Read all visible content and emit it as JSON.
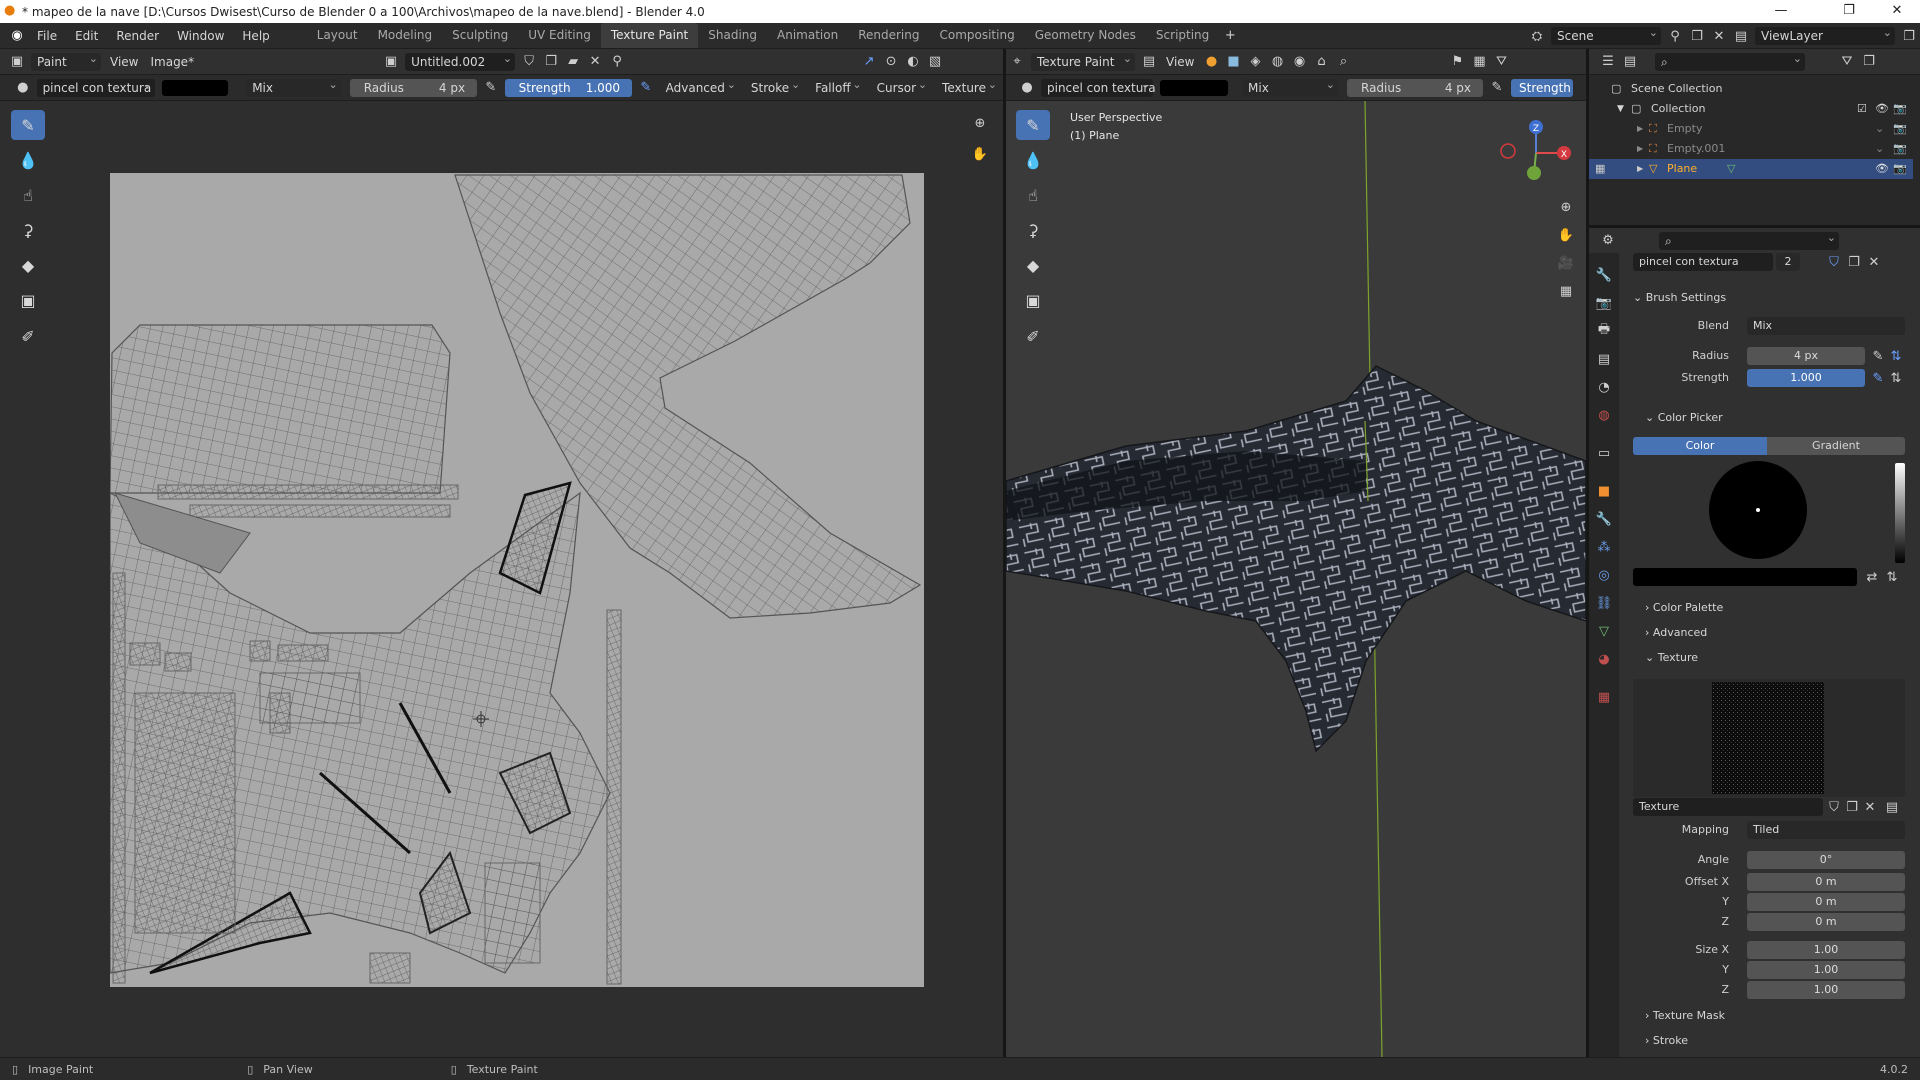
{
  "window": {
    "title": "* mapeo de la nave [D:\\Cursos Dwisest\\Curso de Blender  0 a 100\\Archivos\\mapeo de la nave.blend] - Blender 4.0",
    "controls": [
      "—",
      "❐",
      "✕"
    ]
  },
  "menus": [
    "File",
    "Edit",
    "Render",
    "Window",
    "Help"
  ],
  "workspaces": [
    "Layout",
    "Modeling",
    "Sculpting",
    "UV Editing",
    "Texture Paint",
    "Shading",
    "Animation",
    "Rendering",
    "Compositing",
    "Geometry Nodes",
    "Scripting"
  ],
  "active_workspace": "Texture Paint",
  "scene": {
    "scene_label": "Scene",
    "view_layer": "ViewLayer"
  },
  "image_editor": {
    "mode": "Paint",
    "view_menu": "View",
    "image_menu": "Image*",
    "image_name": "Untitled.002",
    "brush_name": "pincel con textura",
    "blend": "Mix",
    "radius_label": "Radius",
    "radius_value": "4 px",
    "strength_label": "Strength",
    "strength_value": "1.000",
    "dropdowns": [
      "Advanced",
      "Stroke",
      "Falloff",
      "Cursor",
      "Texture"
    ]
  },
  "viewport": {
    "mode": "Texture Paint",
    "view_menu": "View",
    "brush_name": "pincel con textura",
    "blend": "Mix",
    "radius_label": "Radius",
    "radius_value": "4 px",
    "strength_label": "Strength",
    "overlay_line1": "User Perspective",
    "overlay_line2": "(1) Plane",
    "gizmo": {
      "z": "Z",
      "x": "X"
    }
  },
  "outliner": {
    "root": "Scene Collection",
    "collection": "Collection",
    "items": [
      "Empty",
      "Empty.001",
      "Plane"
    ],
    "selected": "Plane"
  },
  "properties": {
    "brush_name": "pincel con textura",
    "brush_users": "2",
    "brush_settings_title": "Brush Settings",
    "blend_label": "Blend",
    "blend_value": "Mix",
    "radius_label": "Radius",
    "radius_value": "4 px",
    "strength_label": "Strength",
    "strength_value": "1.000",
    "strength_fraction": 1.0,
    "color_picker_title": "Color Picker",
    "color_tab": "Color",
    "gradient_tab": "Gradient",
    "color_palette": "Color Palette",
    "advanced": "Advanced",
    "texture_title": "Texture",
    "texture_name": "Texture",
    "mapping_label": "Mapping",
    "mapping_value": "Tiled",
    "angle_label": "Angle",
    "angle_value": "0°",
    "offset_x_label": "Offset X",
    "offset_x": "0 m",
    "y_label": "Y",
    "offset_y": "0 m",
    "z_label": "Z",
    "offset_z": "0 m",
    "size_x_label": "Size X",
    "size_x": "1.00",
    "size_y": "1.00",
    "size_z": "1.00",
    "texture_mask": "Texture Mask",
    "stroke": "Stroke"
  },
  "statusbar": {
    "item1": "Image Paint",
    "item2": "Pan View",
    "item3": "Texture Paint",
    "version": "4.0.2"
  },
  "colors": {
    "accent": "#4772b3",
    "panel": "#303030",
    "uv_bg": "#a9a9a9",
    "active_outline": "#ffaf29"
  }
}
